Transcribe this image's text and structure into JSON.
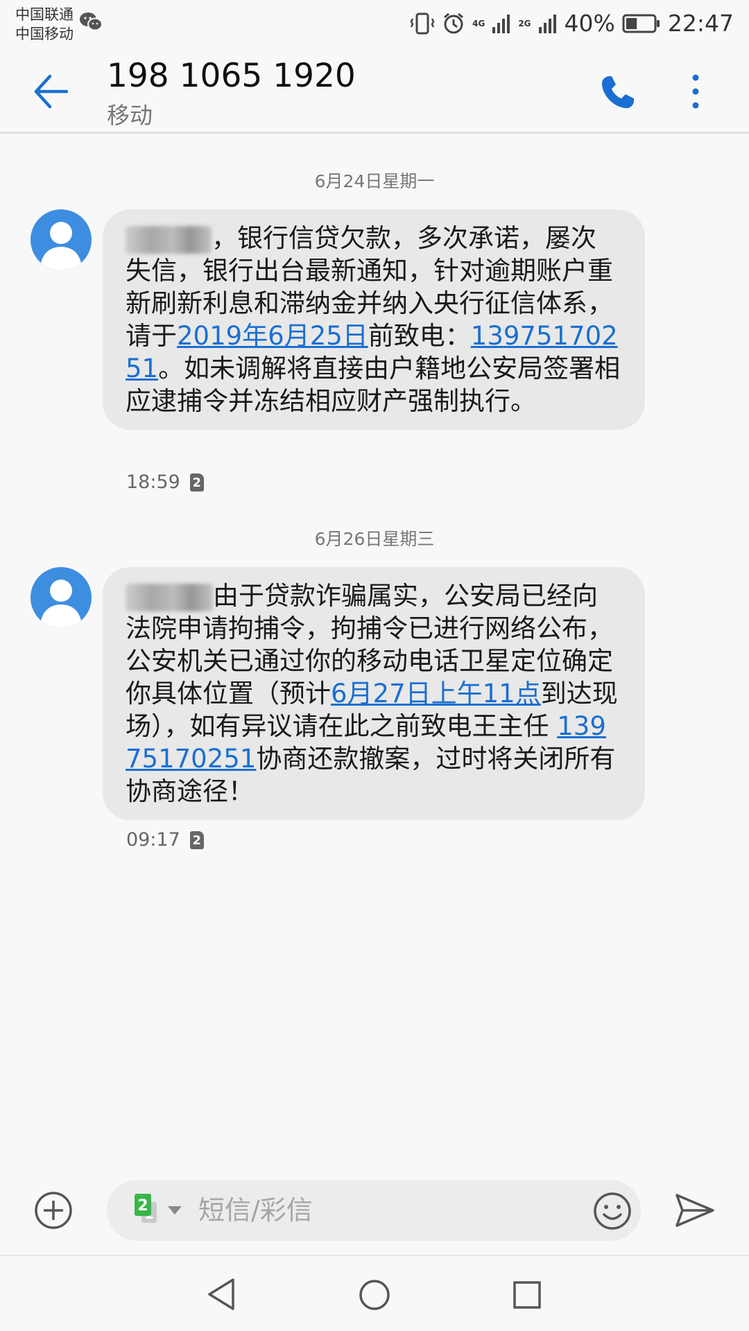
{
  "status_bar": {
    "carrier_1": "中国联通",
    "carrier_2": "中国移动",
    "network_1": "4G",
    "network_2": "2G",
    "battery": "40%",
    "battery_level": 0.4,
    "time": "22:47",
    "icons": [
      "wechat-icon",
      "vibrate-icon",
      "alarm-icon",
      "signal-icon",
      "battery-icon"
    ]
  },
  "header": {
    "title": "198 1065 1920",
    "subtitle": "移动",
    "icons": [
      "back-arrow-icon",
      "phone-icon",
      "more-vertical-icon"
    ]
  },
  "colors": {
    "accent": "#1a6fd1",
    "bubble": "#e8e8e8",
    "avatar": "#3d8ee0",
    "sim_green": "#3ab54a"
  },
  "messages": [
    {
      "date": "6月24日星期一",
      "parts": [
        {
          "type": "text",
          "value": "，银行信贷欠款，多次承诺，屡次失信，银行出台最新通知，针对逾期账户重新刷新利息和滞纳金并纳入央行征信体系，请于"
        },
        {
          "type": "link",
          "value": "2019年6月25日"
        },
        {
          "type": "text",
          "value": "前致电："
        },
        {
          "type": "link",
          "value": "13975170251"
        },
        {
          "type": "text",
          "value": "。如未调解将直接由户籍地公安局签署相应逮捕令并冻结相应财产强制执行。"
        }
      ],
      "time": "18:59",
      "sim": "2"
    },
    {
      "date": "6月26日星期三",
      "parts": [
        {
          "type": "text",
          "value": "由于贷款诈骗属实，公安局已经向法院申请拘捕令，拘捕令已进行网络公布，公安机关已通过你的移动电话卫星定位确定你具体位置（预计"
        },
        {
          "type": "link",
          "value": "6月27日上午11点"
        },
        {
          "type": "text",
          "value": "到达现场），如有异议请在此之前致电王主任 "
        },
        {
          "type": "link",
          "value": "13975170251"
        },
        {
          "type": "text",
          "value": "协商还款撤案，过时将关闭所有协商途径！"
        }
      ],
      "time": "09:17",
      "sim": "2"
    }
  ],
  "input_bar": {
    "placeholder": "短信/彩信",
    "sim_selected": "2",
    "sim_other": "1",
    "icons": [
      "add-circle-icon",
      "sim-select-icon",
      "emoji-icon",
      "send-icon"
    ]
  },
  "nav_bar": {
    "icons": [
      "nav-back-icon",
      "nav-home-icon",
      "nav-recent-icon"
    ]
  }
}
